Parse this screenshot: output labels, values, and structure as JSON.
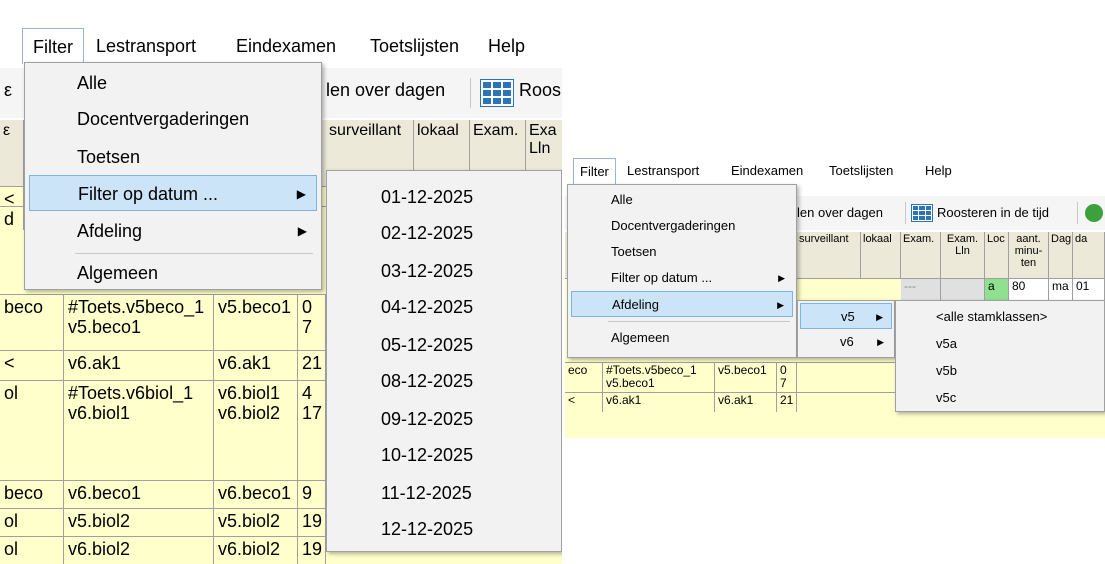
{
  "left": {
    "menubar": [
      "Filter",
      "Lestransport",
      "Eindexamen",
      "Toetslijsten",
      "Help"
    ],
    "toolbar": {
      "text1": "len over dagen",
      "text2": "Roos"
    },
    "headers": [
      "surveillant",
      "lokaal",
      "Exam.",
      "Exa\nLln"
    ],
    "rows": [
      {
        "c0": "beco",
        "c1": "#Toets.v5beco_1\nv5.beco1",
        "c2": "v5.beco1",
        "c3": "0\n7"
      },
      {
        "c0": "<",
        "c1": "v6.ak1",
        "c2": "v6.ak1",
        "c3": "21"
      },
      {
        "c0": "ol",
        "c1": "#Toets.v6biol_1\nv6.biol1",
        "c2": "v6.biol1\nv6.biol2",
        "c3": "4\n17"
      },
      {
        "c0": "beco",
        "c1": "v6.beco1",
        "c2": "v6.beco1",
        "c3": "9"
      },
      {
        "c0": "ol",
        "c1": "v5.biol2",
        "c2": "v5.biol2",
        "c3": "19"
      },
      {
        "c0": "ol",
        "c1": "v6.biol2",
        "c2": "v6.biol2",
        "c3": "19"
      }
    ],
    "menu": [
      "Alle",
      "Docentvergaderingen",
      "Toetsen",
      "Filter op datum ...",
      "Afdeling",
      "Algemeen"
    ],
    "dates": [
      "01-12-2025",
      "02-12-2025",
      "03-12-2025",
      "04-12-2025",
      "05-12-2025",
      "08-12-2025",
      "09-12-2025",
      "10-12-2025",
      "11-12-2025",
      "12-12-2025"
    ],
    "partial": [
      "ε",
      "c",
      "<",
      "d",
      "..."
    ]
  },
  "right": {
    "menubar": [
      "Filter",
      "Lestransport",
      "Eindexamen",
      "Toetslijsten",
      "Help"
    ],
    "toolbar": {
      "text1": "len over dagen",
      "text2": "Roosteren in de tijd"
    },
    "headers": [
      "surveillant",
      "lokaal",
      "Exam.",
      "Exam.\nLln",
      "Loc",
      "aant.\nminu-\nten",
      "Dag",
      "da"
    ],
    "first_row": {
      "dots": "---",
      "loc": "a",
      "minutes": "80",
      "day": "ma",
      "date": "01"
    },
    "rows": [
      {
        "c0": "eco",
        "c1": "#Toets.v5beco_1\nv5.beco1",
        "c2": "v5.beco1",
        "c3": "0\n7"
      },
      {
        "c0": "<",
        "c1": "v6.ak1",
        "c2": "v6.ak1",
        "c3": "21"
      }
    ],
    "menu": [
      "Alle",
      "Docentvergaderingen",
      "Toetsen",
      "Filter op datum ...",
      "Afdeling",
      "Algemeen"
    ],
    "departments": [
      "v5",
      "v6"
    ],
    "classes": [
      "<alle stamklassen>",
      "v5a",
      "v5b",
      "v5c"
    ]
  }
}
